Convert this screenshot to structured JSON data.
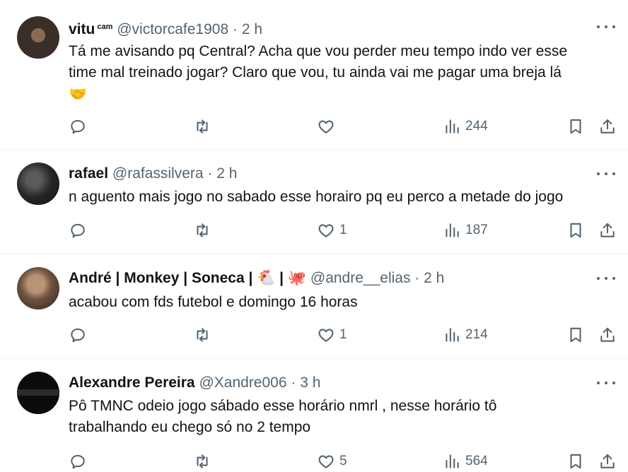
{
  "tweets": [
    {
      "name": "vitu",
      "badge": "cam",
      "handle": "@victorcafe1908",
      "sep": "·",
      "time": "2 h",
      "text_lines": [
        "Tá me avisando pq Central? Acha que vou perder meu tempo indo ver esse",
        "time mal treinado jogar? Claro que vou, tu ainda vai me pagar uma breja lá",
        "🤝"
      ],
      "likes": "",
      "views": "244"
    },
    {
      "name": "rafael",
      "handle": "@rafassilvera",
      "sep": "·",
      "time": "2 h",
      "text_lines": [
        "n aguento mais jogo no sabado esse horairo pq eu perco a metade do jogo"
      ],
      "likes": "1",
      "views": "187"
    },
    {
      "name": "André | Monkey | Soneca | 🐔 | 🐙",
      "handle": "@andre__elias",
      "sep": "·",
      "time": "2 h",
      "text_lines": [
        "acabou com fds futebol e domingo 16  horas"
      ],
      "likes": "1",
      "views": "214"
    },
    {
      "name": "Alexandre Pereira",
      "handle": "@Xandre006",
      "sep": "·",
      "time": "3 h",
      "text_lines": [
        "Pô TMNC odeio jogo sábado esse horário nmrl  , nesse horário tô",
        "trabalhando eu chego só no 2 tempo"
      ],
      "likes": "5",
      "views": "564"
    }
  ],
  "icons": {
    "reply": "reply-icon",
    "retweet": "retweet-icon",
    "like": "heart-icon",
    "views": "views-icon",
    "bookmark": "bookmark-icon",
    "share": "share-icon",
    "more": "more-icon"
  }
}
